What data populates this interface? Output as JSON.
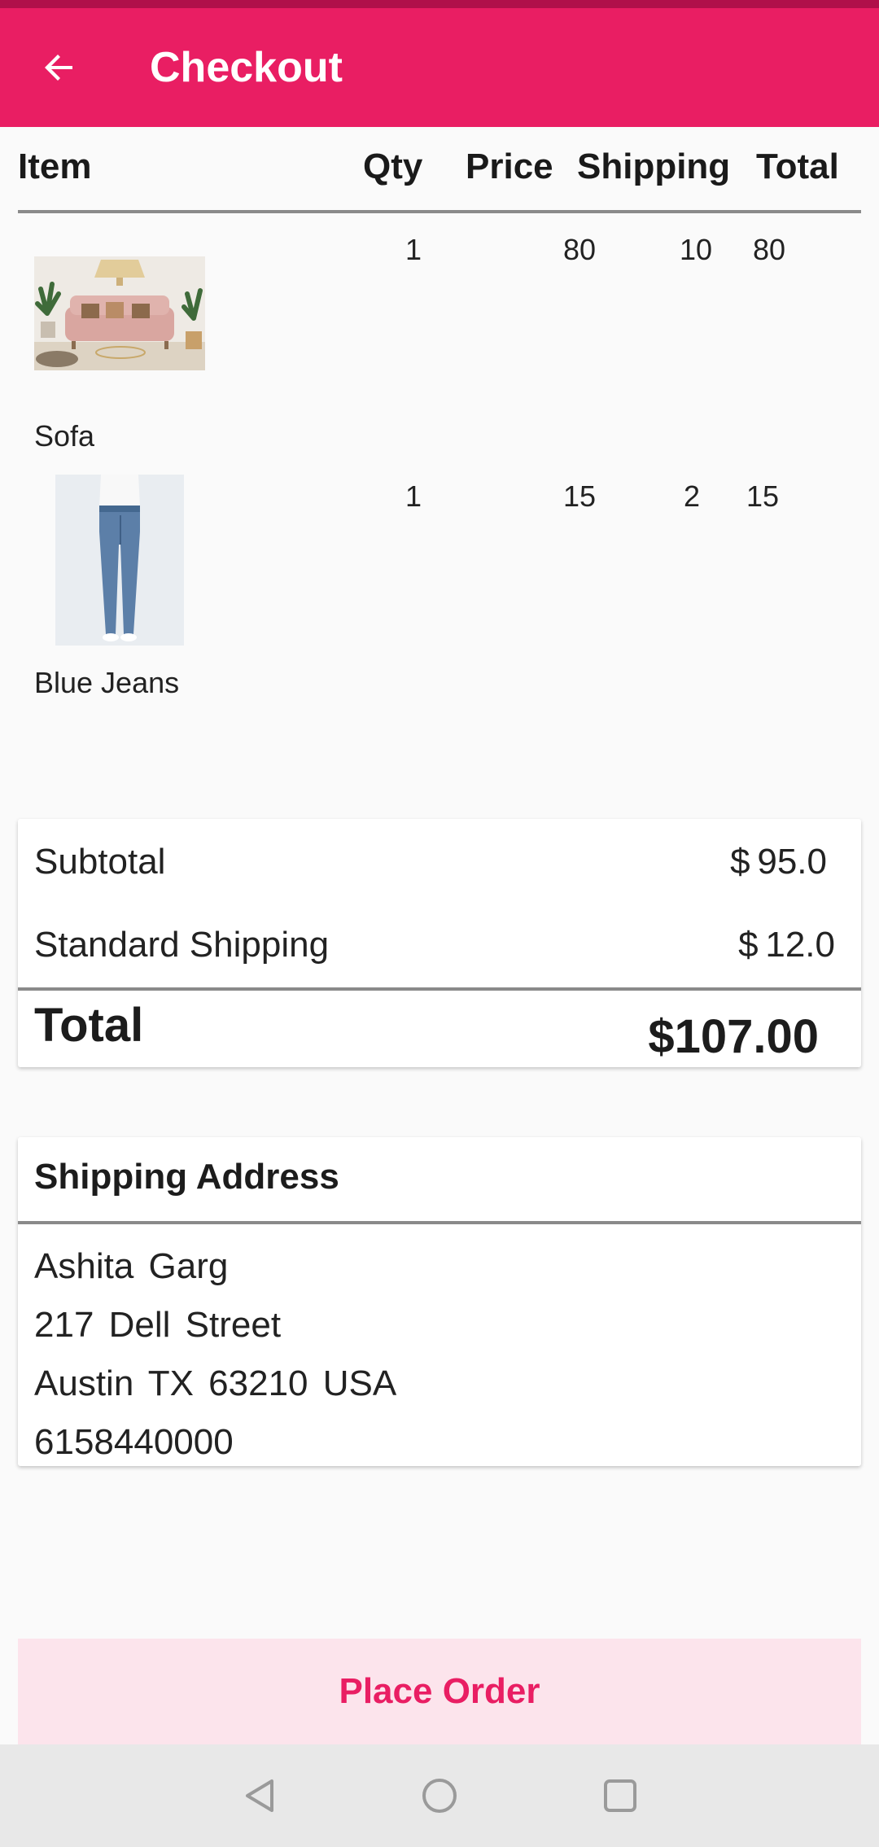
{
  "app": {
    "title": "Checkout"
  },
  "colors": {
    "accent": "#e91e63",
    "status_bar": "#b0104a",
    "button_bg": "#fce4ec"
  },
  "table": {
    "headers": [
      "Item",
      "Qty",
      "Price",
      "Shipping",
      "Total"
    ],
    "rows": [
      {
        "name": "Sofa",
        "qty": "1",
        "price": "80",
        "shipping": "10",
        "total": "80",
        "image_icon": "sofa-product-image"
      },
      {
        "name": "Blue Jeans",
        "qty": "1",
        "price": "15",
        "shipping": "2",
        "total": "15",
        "image_icon": "jeans-product-image"
      }
    ]
  },
  "summary": {
    "subtotal_label": "Subtotal",
    "subtotal_value": "$ 95.0",
    "shipping_label": "Standard Shipping",
    "shipping_value": "$ 12.0",
    "total_label": "Total",
    "total_value": "$107.00"
  },
  "address": {
    "title": "Shipping Address",
    "name": "Ashita  Garg",
    "street": "217 Dell Street",
    "city_line": "Austin   TX   63210  USA",
    "phone": "6158440000"
  },
  "actions": {
    "place_order": "Place Order"
  },
  "icons": {
    "back": "arrow-back-icon",
    "nav_back": "triangle-back-icon",
    "nav_home": "circle-home-icon",
    "nav_recents": "square-recents-icon"
  }
}
